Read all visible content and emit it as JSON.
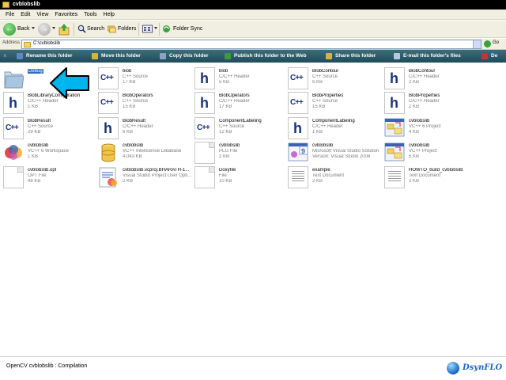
{
  "window": {
    "title": "cvblobslib"
  },
  "menu": [
    "File",
    "Edit",
    "View",
    "Favorites",
    "Tools",
    "Help"
  ],
  "toolbar": {
    "back": "Back",
    "search": "Search",
    "folders": "Folders",
    "folder_sync": "Folder Sync"
  },
  "address": {
    "label": "Address",
    "value": "C:\\cvblobslib",
    "go": "Go"
  },
  "tasks": [
    {
      "label": "Rename this folder",
      "icon": "rename-icon",
      "color": "#5b88c2"
    },
    {
      "label": "Move this folder",
      "icon": "move-folder-icon",
      "color": "#d6b23a"
    },
    {
      "label": "Copy this folder",
      "icon": "copy-folder-icon",
      "color": "#8aa2c8"
    },
    {
      "label": "Publish this folder to the Web",
      "icon": "publish-web-icon",
      "color": "#3c9a3c"
    },
    {
      "label": "Share this folder",
      "icon": "share-folder-icon",
      "color": "#d6b23a"
    },
    {
      "label": "E-mail this folder's files",
      "icon": "email-icon",
      "color": "#b8c7de"
    },
    {
      "label": "De",
      "icon": "delete-icon",
      "color": "#c83232"
    }
  ],
  "files": [
    {
      "name": "Debug",
      "type": "",
      "size": "",
      "icon": "folder-icon",
      "selected": true
    },
    {
      "name": "blob",
      "type": "C++ Source",
      "size": "17 KB",
      "icon": "cpp-source-icon"
    },
    {
      "name": "blob",
      "type": "C/C++ Header",
      "size": "5 KB",
      "icon": "header-file-icon"
    },
    {
      "name": "BlobContour",
      "type": "C++ Source",
      "size": "6 KB",
      "icon": "cpp-source-icon"
    },
    {
      "name": "BlobContour",
      "type": "C/C++ Header",
      "size": "2 KB",
      "icon": "header-file-icon"
    },
    {
      "name": "BlobLibraryConfiguration",
      "type": "C/C++ Header",
      "size": "1 KB",
      "icon": "header-file-icon"
    },
    {
      "name": "BlobOperators",
      "type": "C++ Source",
      "size": "15 KB",
      "icon": "cpp-source-icon"
    },
    {
      "name": "BlobOperators",
      "type": "C/C++ Header",
      "size": "17 KB",
      "icon": "header-file-icon"
    },
    {
      "name": "BlobProperties",
      "type": "C++ Source",
      "size": "15 KB",
      "icon": "cpp-source-icon"
    },
    {
      "name": "BlobProperties",
      "type": "C/C++ Header",
      "size": "2 KB",
      "icon": "header-file-icon"
    },
    {
      "name": "BlobResult",
      "type": "C++ Source",
      "size": "29 KB",
      "icon": "cpp-source-icon"
    },
    {
      "name": "BlobResult",
      "type": "C/C++ Header",
      "size": "6 KB",
      "icon": "header-file-icon"
    },
    {
      "name": "ComponentLabeling",
      "type": "C++ Source",
      "size": "12 KB",
      "icon": "cpp-source-icon"
    },
    {
      "name": "ComponentLabeling",
      "type": "C/C++ Header",
      "size": "1 KB",
      "icon": "header-file-icon"
    },
    {
      "name": "cvblobslib",
      "type": "VC++ 6 Project",
      "size": "4 KB",
      "icon": "vc6-project-icon"
    },
    {
      "name": "cvblobslib",
      "type": "VC++ 6 Workspace",
      "size": "1 KB",
      "icon": "vc6-workspace-icon"
    },
    {
      "name": "cvblobslib",
      "type": "VC++ Intellisense Database",
      "size": "4,043 KB",
      "icon": "intellisense-db-icon"
    },
    {
      "name": "cvblobslib",
      "type": "PLG File",
      "size": "2 KB",
      "icon": "plg-file-icon"
    },
    {
      "name": "cvblobslib",
      "type": "Microsoft Visual Studio Solution",
      "size": "Version: Visual Studio 2008",
      "icon": "vs-solution-icon"
    },
    {
      "name": "cvblobslib",
      "type": "VC++ Project",
      "size": "5 KB",
      "icon": "vc-project-icon"
    },
    {
      "name": "cvblobslib.opt",
      "type": "OPT File",
      "size": "48 KB",
      "icon": "opt-file-icon"
    },
    {
      "name": "cvblobslib.vcproj.BHARATH-1...",
      "type": "Visual Studio Project User Opti...",
      "size": "2 KB",
      "icon": "vcproj-user-icon"
    },
    {
      "name": "Doxyfile",
      "type": "File",
      "size": "10 KB",
      "icon": "generic-file-icon"
    },
    {
      "name": "example",
      "type": "Text Document",
      "size": "2 KB",
      "icon": "text-document-icon"
    },
    {
      "name": "HOWTO_build_cvblobslib",
      "type": "Text Document",
      "size": "2 KB",
      "icon": "text-document-icon"
    }
  ],
  "status": {
    "text": "OpenCV cvblobslib : Compilation"
  },
  "brand": {
    "text": "DsynFLO"
  },
  "colors": {
    "taskbar": "#2b5a69",
    "arrow": "#00b4f0",
    "selection": "#316ac5"
  }
}
